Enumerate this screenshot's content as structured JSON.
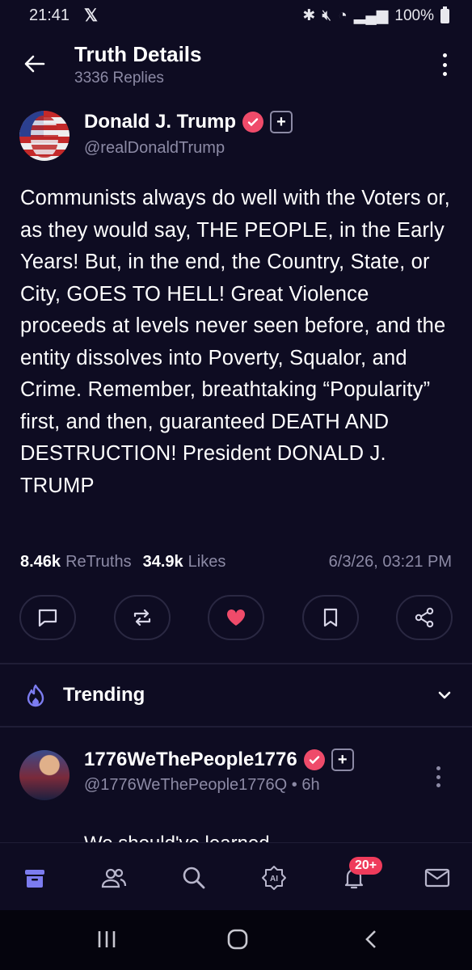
{
  "status_bar": {
    "time": "21:41",
    "x_glyph": "𝕏",
    "battery": "100%"
  },
  "header": {
    "title": "Truth Details",
    "subtitle": "3336 Replies"
  },
  "post": {
    "author_name": "Donald J. Trump",
    "handle": "@realDonaldTrump",
    "body": "Communists always do well with the Voters or, as they would say, THE PEOPLE, in the Early Years! But, in the end, the Country, State, or City, GOES TO HELL! Great Violence proceeds at levels never seen before, and the entity dissolves into Poverty, Squalor, and Crime. Remember, breathtaking “Popularity” first, and then, guaranteed DEATH AND DESTRUCTION! President DONALD J. TRUMP",
    "retruths_count": "8.46k",
    "retruths_label": "ReTruths",
    "likes_count": "34.9k",
    "likes_label": "Likes",
    "timestamp": "6/3/26, 03:21 PM"
  },
  "actions": [
    "reply-icon",
    "retruth-icon",
    "like-icon",
    "bookmark-icon",
    "share-icon"
  ],
  "trending": {
    "label": "Trending"
  },
  "trending_post": {
    "author_name": "1776WeThePeople1776",
    "handle": "@1776WeThePeople1776Q",
    "separator": "•",
    "age": "6h",
    "body_peek": "We should've learned"
  },
  "bottom_nav": {
    "notifications_badge": "20+",
    "items": [
      "home-icon",
      "groups-icon",
      "search-icon",
      "ai-icon",
      "notifications-icon",
      "messages-icon"
    ]
  },
  "colors": {
    "background": "#0e0c22",
    "accent": "#ef4b6a",
    "muted_text": "#8c8aa5",
    "nav_active": "#7c7cf0"
  }
}
